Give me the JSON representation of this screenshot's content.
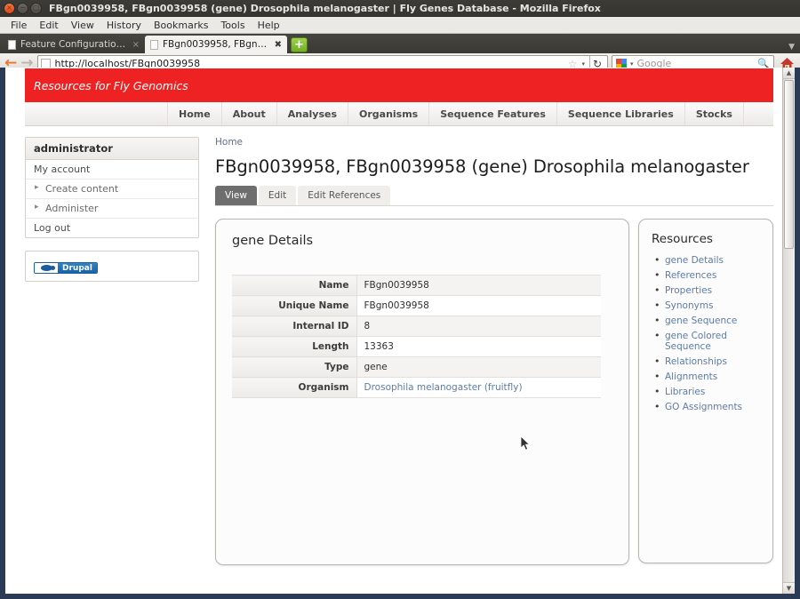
{
  "browser": {
    "window_title": "FBgn0039958, FBgn0039958 (gene) Drosophila melanogaster | Fly Genes Database - Mozilla Firefox",
    "window_controls": {
      "close": "close-icon",
      "minimize": "minimize-icon",
      "maximize": "maximize-icon"
    },
    "menubar": [
      "File",
      "Edit",
      "View",
      "History",
      "Bookmarks",
      "Tools",
      "Help"
    ],
    "tabs": [
      {
        "label": "Feature Configuration | Fly ...",
        "active": false,
        "close": "×"
      },
      {
        "label": "FBgn0039958, FBgn0039958...",
        "active": true,
        "close": "✖"
      }
    ],
    "new_tab_label": "+",
    "toolbar": {
      "back": "←",
      "forward": "→",
      "url": "http://localhost/FBgn0039958",
      "star": "☆",
      "caret": "▾",
      "reload": "↻",
      "search_placeholder": "Google",
      "search_magnifier": "search-icon",
      "home": "home-icon"
    }
  },
  "site": {
    "slogan": "Resources for Fly Genomics",
    "banner_color": "#ee2222",
    "nav": [
      "Home",
      "About",
      "Analyses",
      "Organisms",
      "Sequence Features",
      "Sequence Libraries",
      "Stocks"
    ]
  },
  "sidebar": {
    "user_block": {
      "title": "administrator",
      "items": [
        {
          "label": "My account",
          "sub": false
        },
        {
          "label": "Create content",
          "sub": true
        },
        {
          "label": "Administer",
          "sub": true
        },
        {
          "label": "Log out",
          "sub": false
        }
      ]
    },
    "drupal_badge": "Drupal"
  },
  "main": {
    "breadcrumb": "Home",
    "page_title": "FBgn0039958, FBgn0039958 (gene) Drosophila melanogaster",
    "tabs": [
      {
        "label": "View",
        "active": true
      },
      {
        "label": "Edit",
        "active": false
      },
      {
        "label": "Edit References",
        "active": false
      }
    ],
    "details_panel": {
      "heading": "gene Details",
      "rows": [
        {
          "label": "Name",
          "value": "FBgn0039958",
          "link": false
        },
        {
          "label": "Unique Name",
          "value": "FBgn0039958",
          "link": false
        },
        {
          "label": "Internal ID",
          "value": "8",
          "link": false
        },
        {
          "label": "Length",
          "value": "13363",
          "link": false
        },
        {
          "label": "Type",
          "value": "gene",
          "link": false
        },
        {
          "label": "Organism",
          "value": "Drosophila melanogaster (fruitfly)",
          "link": true
        }
      ]
    },
    "resources_panel": {
      "heading": "Resources",
      "items": [
        "gene Details",
        "References",
        "Properties",
        "Synonyms",
        "gene Sequence",
        "gene Colored Sequence",
        "Relationships",
        "Alignments",
        "Libraries",
        "GO Assignments"
      ]
    }
  }
}
